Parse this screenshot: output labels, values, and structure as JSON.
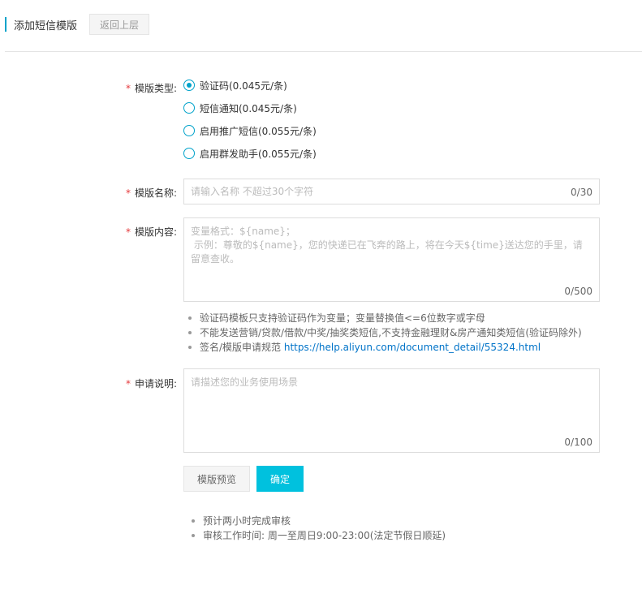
{
  "header": {
    "title": "添加短信模版",
    "back_label": "返回上层"
  },
  "form": {
    "required_mark": "*",
    "type": {
      "label": "模版类型:",
      "options": [
        {
          "label": "验证码(0.045元/条)",
          "checked": true
        },
        {
          "label": "短信通知(0.045元/条)",
          "checked": false
        },
        {
          "label": "启用推广短信(0.055元/条)",
          "checked": false
        },
        {
          "label": "启用群发助手(0.055元/条)",
          "checked": false
        }
      ]
    },
    "name": {
      "label": "模版名称:",
      "placeholder": "请输入名称 不超过30个字符",
      "value": "",
      "counter": "0/30"
    },
    "content": {
      "label": "模版内容:",
      "placeholder": "变量格式：${name}；\n 示例：尊敬的${name}，您的快递已在飞奔的路上，将在今天${time}送达您的手里，请留意查收。",
      "value": "",
      "counter": "0/500"
    },
    "content_tips": {
      "tip1": "验证码模板只支持验证码作为变量；变量替换值<=6位数字或字母",
      "tip2": "不能发送营销/贷款/借款/中奖/抽奖类短信,不支持金融理财&房产通知类短信(验证码除外)",
      "tip3_prefix": "签名/模版申请规范 ",
      "tip3_link": "https://help.aliyun.com/document_detail/55324.html"
    },
    "description": {
      "label": "申请说明:",
      "placeholder": "请描述您的业务使用场景",
      "value": "",
      "counter": "0/100"
    },
    "buttons": {
      "preview_label": "模版预览",
      "confirm_label": "确定"
    },
    "footer_tips": {
      "tip1": "预计两小时完成审核",
      "tip2": "审核工作时间: 周一至周日9:00-23:00(法定节假日顺延)"
    }
  },
  "colors": {
    "accent": "#00a2ca",
    "primary_button": "#00c1de",
    "required": "#e4393c",
    "link": "#0073c8"
  }
}
